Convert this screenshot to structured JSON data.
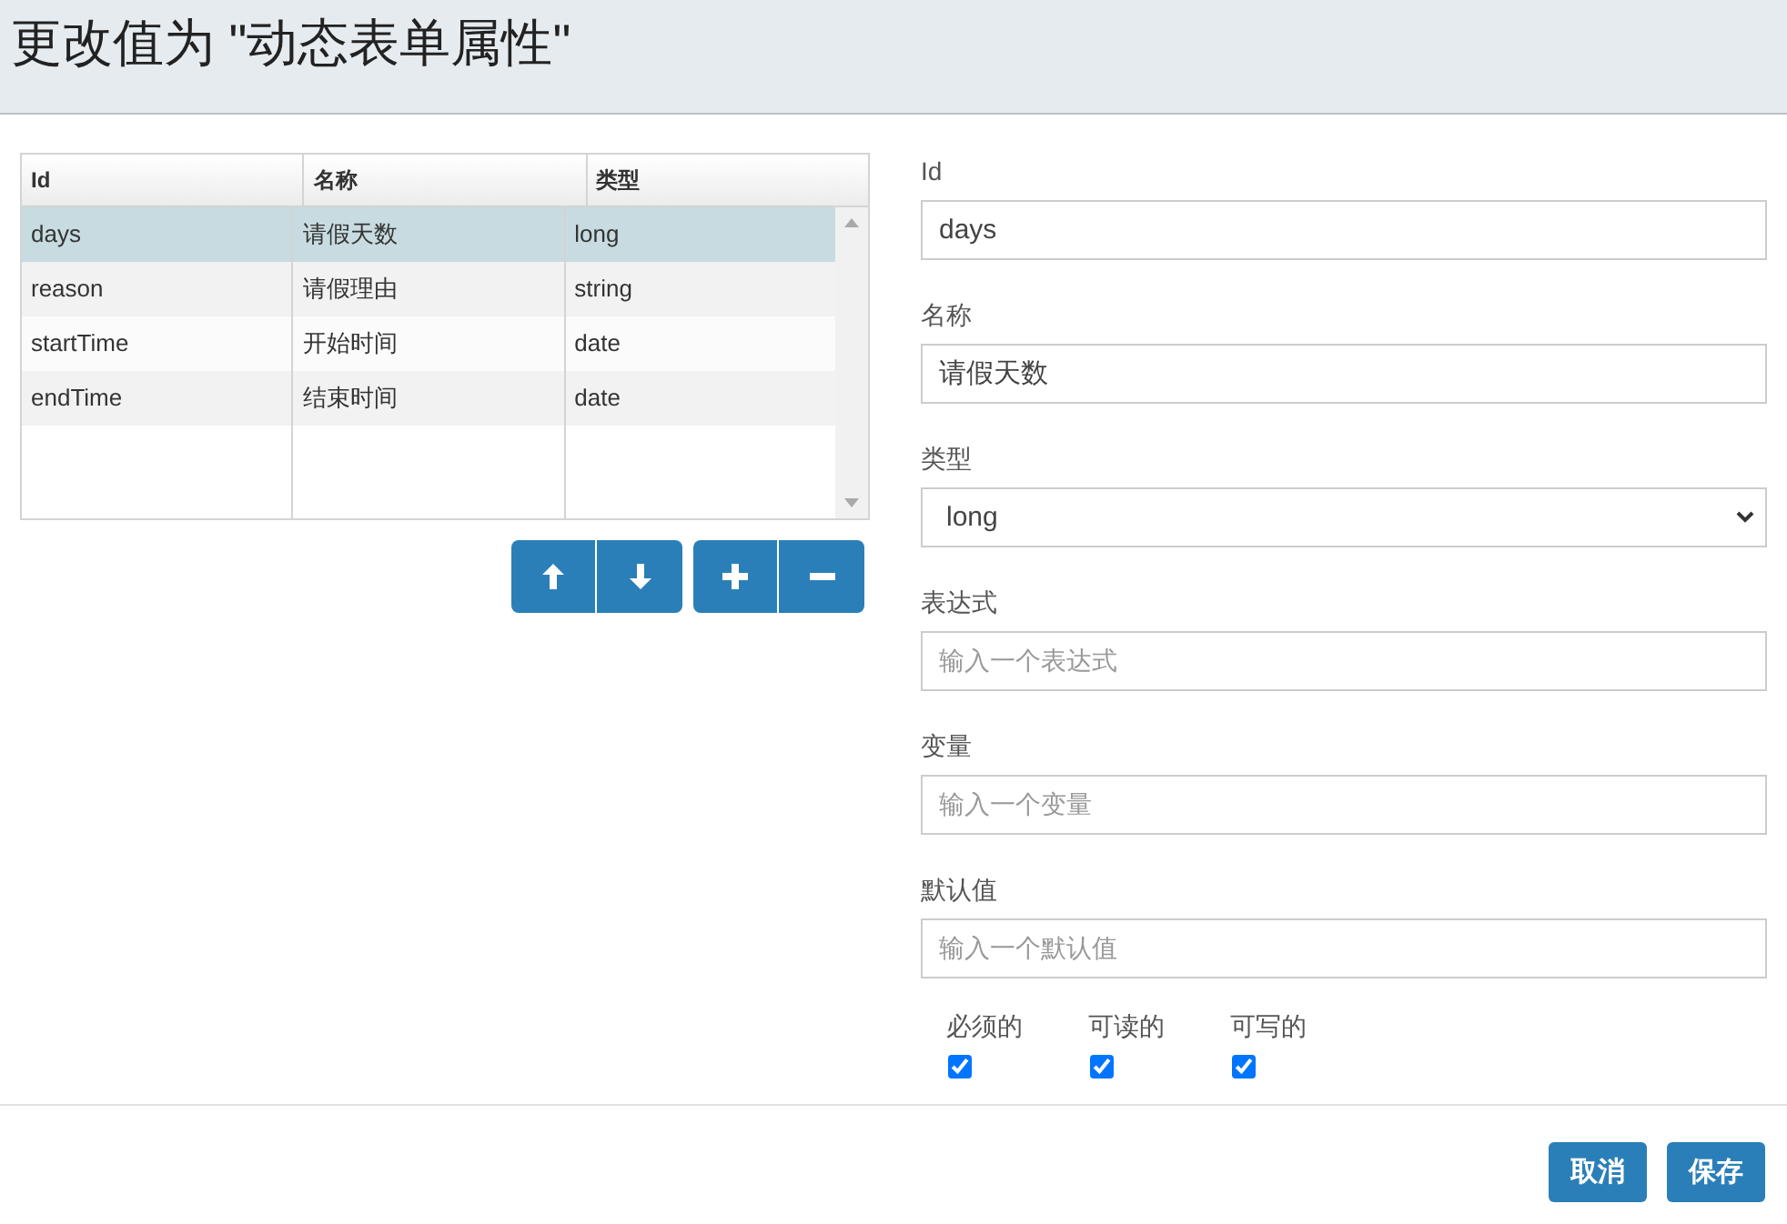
{
  "dialog": {
    "title": "更改值为 \"动态表单属性\""
  },
  "table": {
    "columns": [
      "Id",
      "名称",
      "类型"
    ],
    "rows": [
      {
        "cells": [
          "days",
          "请假天数",
          "long"
        ],
        "selected": true
      },
      {
        "cells": [
          "reason",
          "请假理由",
          "string"
        ],
        "selected": false
      },
      {
        "cells": [
          "startTime",
          "开始时间",
          "date"
        ],
        "selected": false
      },
      {
        "cells": [
          "endTime",
          "结束时间",
          "date"
        ],
        "selected": false
      }
    ]
  },
  "button_groups": [
    [
      {
        "kind": "up"
      },
      {
        "kind": "down"
      }
    ],
    [
      {
        "kind": "add"
      },
      {
        "kind": "remove"
      }
    ]
  ],
  "fields": [
    {
      "kind": "text",
      "label": "Id",
      "value": "days"
    },
    {
      "kind": "text",
      "label": "名称",
      "value": "请假天数"
    },
    {
      "kind": "select",
      "label": "类型",
      "value": "long"
    },
    {
      "kind": "text",
      "label": "表达式",
      "placeholder": "输入一个表达式"
    },
    {
      "kind": "text",
      "label": "变量",
      "placeholder": "输入一个变量"
    },
    {
      "kind": "text",
      "label": "默认值",
      "placeholder": "输入一个默认值"
    }
  ],
  "checkboxes": [
    {
      "label": "必须的",
      "checked": true
    },
    {
      "label": "可读的",
      "checked": true
    },
    {
      "label": "可写的",
      "checked": true
    }
  ],
  "footer_buttons": [
    "取消",
    "保存"
  ]
}
